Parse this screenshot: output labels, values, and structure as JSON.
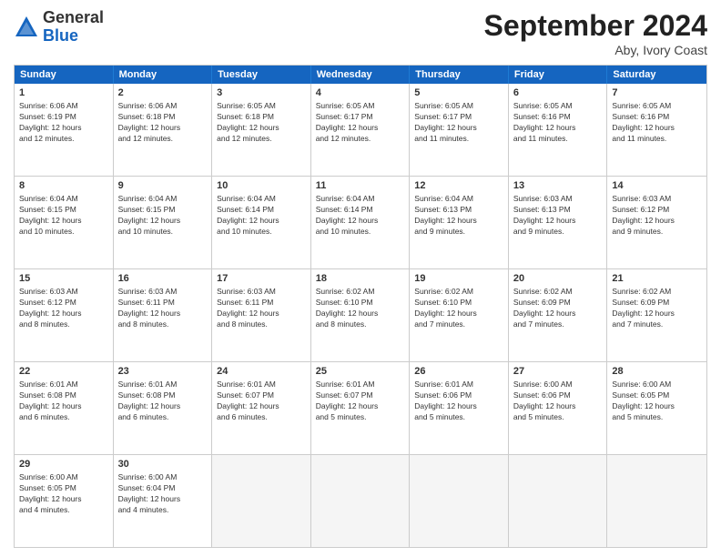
{
  "header": {
    "logo_general": "General",
    "logo_blue": "Blue",
    "month_title": "September 2024",
    "location": "Aby, Ivory Coast"
  },
  "weekdays": [
    "Sunday",
    "Monday",
    "Tuesday",
    "Wednesday",
    "Thursday",
    "Friday",
    "Saturday"
  ],
  "rows": [
    [
      {
        "day": "1",
        "info": "Sunrise: 6:06 AM\nSunset: 6:19 PM\nDaylight: 12 hours\nand 12 minutes."
      },
      {
        "day": "2",
        "info": "Sunrise: 6:06 AM\nSunset: 6:18 PM\nDaylight: 12 hours\nand 12 minutes."
      },
      {
        "day": "3",
        "info": "Sunrise: 6:05 AM\nSunset: 6:18 PM\nDaylight: 12 hours\nand 12 minutes."
      },
      {
        "day": "4",
        "info": "Sunrise: 6:05 AM\nSunset: 6:17 PM\nDaylight: 12 hours\nand 12 minutes."
      },
      {
        "day": "5",
        "info": "Sunrise: 6:05 AM\nSunset: 6:17 PM\nDaylight: 12 hours\nand 11 minutes."
      },
      {
        "day": "6",
        "info": "Sunrise: 6:05 AM\nSunset: 6:16 PM\nDaylight: 12 hours\nand 11 minutes."
      },
      {
        "day": "7",
        "info": "Sunrise: 6:05 AM\nSunset: 6:16 PM\nDaylight: 12 hours\nand 11 minutes."
      }
    ],
    [
      {
        "day": "8",
        "info": "Sunrise: 6:04 AM\nSunset: 6:15 PM\nDaylight: 12 hours\nand 10 minutes."
      },
      {
        "day": "9",
        "info": "Sunrise: 6:04 AM\nSunset: 6:15 PM\nDaylight: 12 hours\nand 10 minutes."
      },
      {
        "day": "10",
        "info": "Sunrise: 6:04 AM\nSunset: 6:14 PM\nDaylight: 12 hours\nand 10 minutes."
      },
      {
        "day": "11",
        "info": "Sunrise: 6:04 AM\nSunset: 6:14 PM\nDaylight: 12 hours\nand 10 minutes."
      },
      {
        "day": "12",
        "info": "Sunrise: 6:04 AM\nSunset: 6:13 PM\nDaylight: 12 hours\nand 9 minutes."
      },
      {
        "day": "13",
        "info": "Sunrise: 6:03 AM\nSunset: 6:13 PM\nDaylight: 12 hours\nand 9 minutes."
      },
      {
        "day": "14",
        "info": "Sunrise: 6:03 AM\nSunset: 6:12 PM\nDaylight: 12 hours\nand 9 minutes."
      }
    ],
    [
      {
        "day": "15",
        "info": "Sunrise: 6:03 AM\nSunset: 6:12 PM\nDaylight: 12 hours\nand 8 minutes."
      },
      {
        "day": "16",
        "info": "Sunrise: 6:03 AM\nSunset: 6:11 PM\nDaylight: 12 hours\nand 8 minutes."
      },
      {
        "day": "17",
        "info": "Sunrise: 6:03 AM\nSunset: 6:11 PM\nDaylight: 12 hours\nand 8 minutes."
      },
      {
        "day": "18",
        "info": "Sunrise: 6:02 AM\nSunset: 6:10 PM\nDaylight: 12 hours\nand 8 minutes."
      },
      {
        "day": "19",
        "info": "Sunrise: 6:02 AM\nSunset: 6:10 PM\nDaylight: 12 hours\nand 7 minutes."
      },
      {
        "day": "20",
        "info": "Sunrise: 6:02 AM\nSunset: 6:09 PM\nDaylight: 12 hours\nand 7 minutes."
      },
      {
        "day": "21",
        "info": "Sunrise: 6:02 AM\nSunset: 6:09 PM\nDaylight: 12 hours\nand 7 minutes."
      }
    ],
    [
      {
        "day": "22",
        "info": "Sunrise: 6:01 AM\nSunset: 6:08 PM\nDaylight: 12 hours\nand 6 minutes."
      },
      {
        "day": "23",
        "info": "Sunrise: 6:01 AM\nSunset: 6:08 PM\nDaylight: 12 hours\nand 6 minutes."
      },
      {
        "day": "24",
        "info": "Sunrise: 6:01 AM\nSunset: 6:07 PM\nDaylight: 12 hours\nand 6 minutes."
      },
      {
        "day": "25",
        "info": "Sunrise: 6:01 AM\nSunset: 6:07 PM\nDaylight: 12 hours\nand 5 minutes."
      },
      {
        "day": "26",
        "info": "Sunrise: 6:01 AM\nSunset: 6:06 PM\nDaylight: 12 hours\nand 5 minutes."
      },
      {
        "day": "27",
        "info": "Sunrise: 6:00 AM\nSunset: 6:06 PM\nDaylight: 12 hours\nand 5 minutes."
      },
      {
        "day": "28",
        "info": "Sunrise: 6:00 AM\nSunset: 6:05 PM\nDaylight: 12 hours\nand 5 minutes."
      }
    ],
    [
      {
        "day": "29",
        "info": "Sunrise: 6:00 AM\nSunset: 6:05 PM\nDaylight: 12 hours\nand 4 minutes."
      },
      {
        "day": "30",
        "info": "Sunrise: 6:00 AM\nSunset: 6:04 PM\nDaylight: 12 hours\nand 4 minutes."
      },
      {
        "day": "",
        "info": ""
      },
      {
        "day": "",
        "info": ""
      },
      {
        "day": "",
        "info": ""
      },
      {
        "day": "",
        "info": ""
      },
      {
        "day": "",
        "info": ""
      }
    ]
  ]
}
